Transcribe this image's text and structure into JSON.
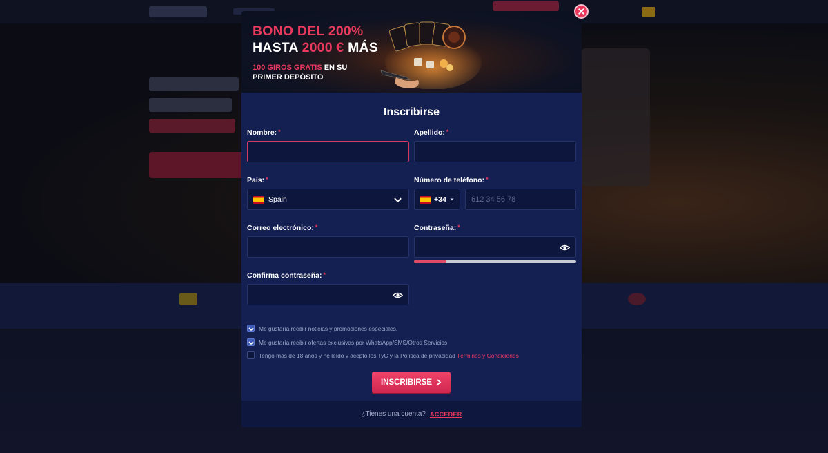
{
  "banner": {
    "title_line1": "BONO DEL 200%",
    "title_line2_a": "HASTA ",
    "title_line2_b": "2000 €",
    "title_line2_c": " MÁS",
    "sub_line1_a": "100 GIROS GRATIS",
    "sub_line1_b": " EN SU",
    "sub_line2": "PRIMER DEPÓSITO"
  },
  "form": {
    "title": "Inscribirse",
    "first_name_label": "Nombre:",
    "last_name_label": "Apellido:",
    "country_label": "País:",
    "country_value": "Spain",
    "phone_label": "Número de teléfono:",
    "phone_code": "+34",
    "phone_placeholder": "612 34 56 78",
    "email_label": "Correo electrónico:",
    "password_label": "Contraseña:",
    "password_strength": 0.2,
    "confirm_password_label": "Confirma contraseña:",
    "required_mark": "*"
  },
  "checkboxes": [
    {
      "label": "Me gustaría recibir noticias y promociones especiales.",
      "checked": true
    },
    {
      "label": "Me gustaría recibir ofertas exclusivas por WhatsApp/SMS/Otros Servicios",
      "checked": true
    },
    {
      "label": "Tengo más de 18 años y he leído y acepto los TyC y la Política de privacidad",
      "link": "Términos y Condiciones",
      "checked": false
    }
  ],
  "submit_label": "INSCRIBIRSE",
  "footer": {
    "question": "¿Tienes una cuenta?",
    "login_link": "ACCEDER"
  },
  "colors": {
    "accent": "#e9395d",
    "modal_bg": "#142052",
    "field_bg": "#0d163c"
  },
  "icons": [
    "close-icon",
    "spain-flag-icon",
    "chevron-down-icon",
    "caret-down-icon",
    "eye-icon",
    "check-icon",
    "chevron-right-icon"
  ]
}
